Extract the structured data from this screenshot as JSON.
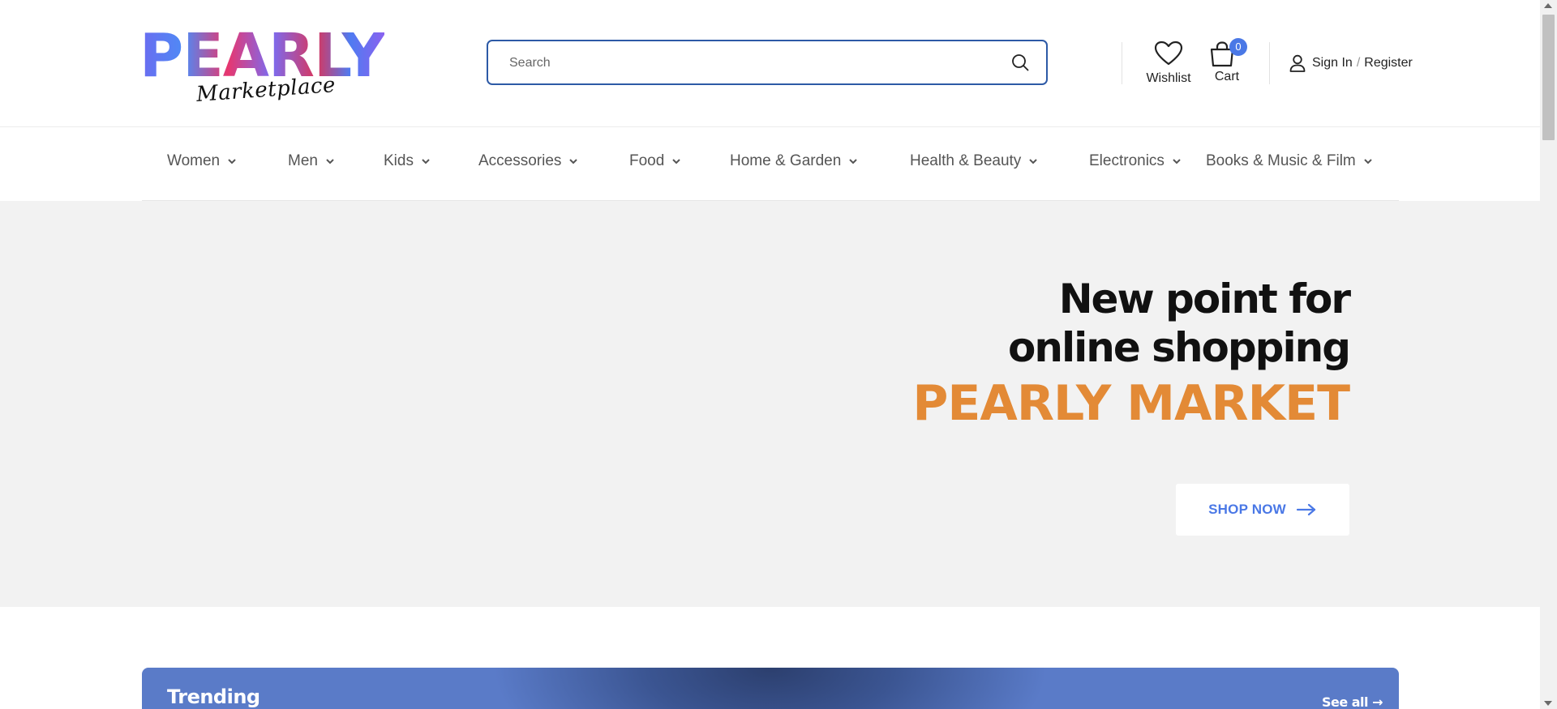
{
  "logo": {
    "main": "PEARLY",
    "sub": "Marketplace"
  },
  "search": {
    "placeholder": "Search"
  },
  "header": {
    "wishlist_label": "Wishlist",
    "cart_label": "Cart",
    "cart_count": "0",
    "sign_in": "Sign In",
    "separator": "/",
    "register": "Register"
  },
  "nav": {
    "items": [
      {
        "label": "Women"
      },
      {
        "label": "Men"
      },
      {
        "label": "Kids"
      },
      {
        "label": "Accessories"
      },
      {
        "label": "Food"
      },
      {
        "label": "Home & Garden"
      },
      {
        "label": "Health & Beauty"
      },
      {
        "label": "Electronics"
      },
      {
        "label": "Books & Music & Film"
      }
    ]
  },
  "hero": {
    "line1": "New point for",
    "line2": "online shopping",
    "brand": "PEARLY MARKET",
    "cta": "SHOP NOW"
  },
  "trending": {
    "title": "Trending",
    "see_all": "See all →"
  },
  "colors": {
    "accent": "#4a78e6",
    "brand_orange": "#e38a36",
    "search_border": "#2d5aa6",
    "hero_bg": "#f2f2f2"
  }
}
